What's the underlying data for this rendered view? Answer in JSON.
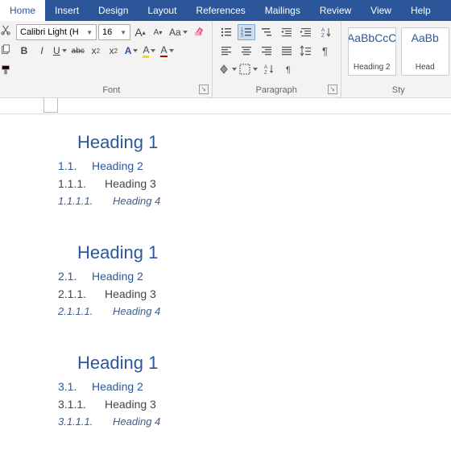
{
  "tabs": {
    "home": "Home",
    "insert": "Insert",
    "design": "Design",
    "layout": "Layout",
    "references": "References",
    "mailings": "Mailings",
    "review": "Review",
    "view": "View",
    "help": "Help"
  },
  "font": {
    "group_label": "Font",
    "name": "Calibri Light (H",
    "size": "16",
    "grow": "A",
    "shrink": "A",
    "case": "Aa",
    "bold": "B",
    "italic": "I",
    "underline": "U",
    "strike": "abc",
    "sub": "x",
    "sub2": "2",
    "sup": "x",
    "sup2": "2",
    "effects": "A",
    "highlight": "A",
    "color": "A"
  },
  "paragraph": {
    "group_label": "Paragraph"
  },
  "styles": {
    "group_label": "Sty",
    "preview1": "AaBbCcC",
    "label1": "Heading 2",
    "preview2": "AaBb",
    "label2": "Head"
  },
  "doc": {
    "sections": [
      {
        "h1": "Heading 1",
        "h2n": "1.1.",
        "h2": "Heading 2",
        "h3n": "1.1.1.",
        "h3": "Heading 3",
        "h4n": "1.1.1.1.",
        "h4": "Heading 4"
      },
      {
        "h1": "Heading 1",
        "h2n": "2.1.",
        "h2": "Heading 2",
        "h3n": "2.1.1.",
        "h3": "Heading 3",
        "h4n": "2.1.1.1.",
        "h4": "Heading 4"
      },
      {
        "h1": "Heading 1",
        "h2n": "3.1.",
        "h2": "Heading 2",
        "h3n": "3.1.1.",
        "h3": "Heading 3",
        "h4n": "3.1.1.1.",
        "h4": "Heading 4"
      }
    ]
  }
}
